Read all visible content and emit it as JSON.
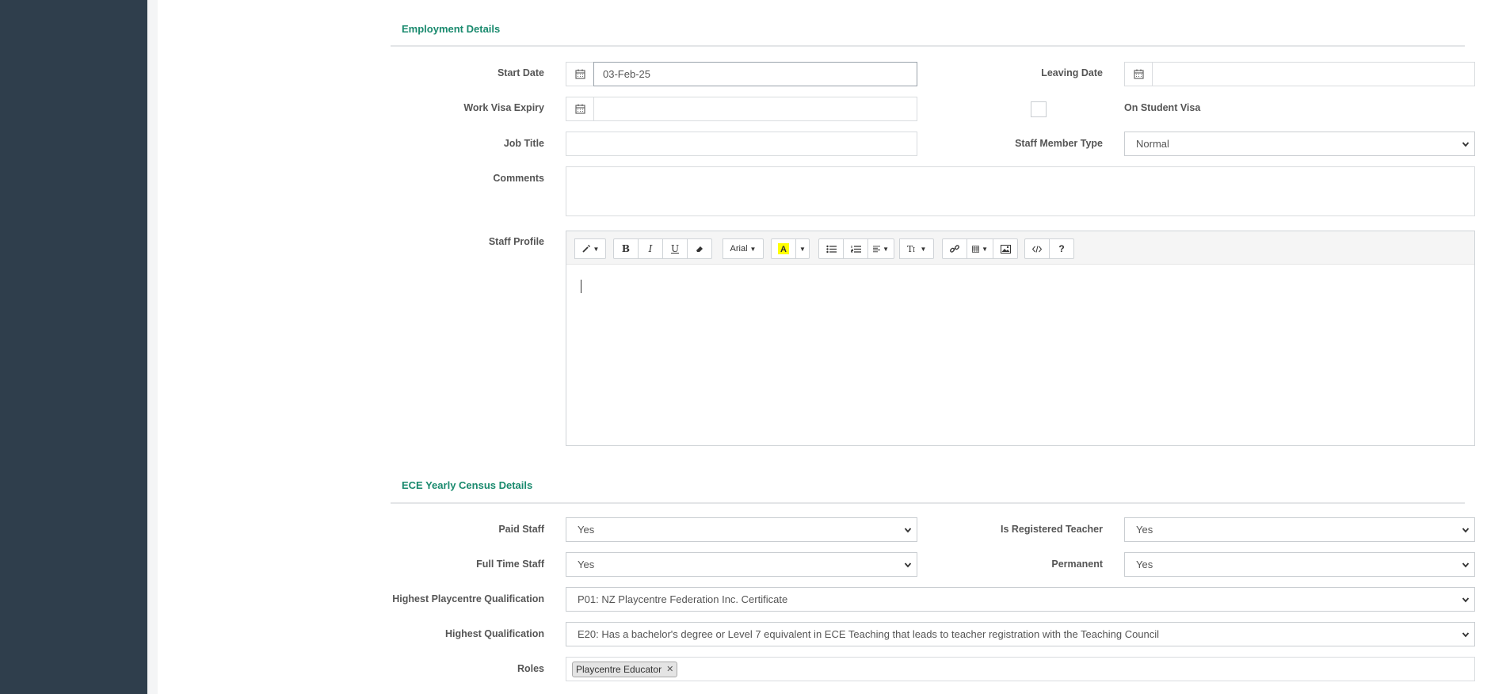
{
  "employment": {
    "title": "Employment Details",
    "start_date_label": "Start Date",
    "start_date_value": "03-Feb-25",
    "leaving_date_label": "Leaving Date",
    "leaving_date_value": "",
    "work_visa_label": "Work Visa Expiry",
    "work_visa_value": "",
    "student_visa_label": "On Student Visa",
    "job_title_label": "Job Title",
    "job_title_value": "",
    "staff_type_label": "Staff Member Type",
    "staff_type_value": "Normal",
    "comments_label": "Comments",
    "profile_label": "Staff Profile"
  },
  "editor": {
    "bold": "B",
    "italic": "I",
    "underline": "U",
    "font_name": "Arial",
    "help": "?"
  },
  "census": {
    "title": "ECE Yearly Census Details",
    "paid_staff_label": "Paid Staff",
    "paid_staff_value": "Yes",
    "registered_teacher_label": "Is Registered Teacher",
    "registered_teacher_value": "Yes",
    "full_time_label": "Full Time Staff",
    "full_time_value": "Yes",
    "permanent_label": "Permanent",
    "permanent_value": "Yes",
    "playcentre_qual_label": "Highest Playcentre Qualification",
    "playcentre_qual_value": "P01: NZ Playcentre Federation Inc. Certificate",
    "highest_qual_label": "Highest Qualification",
    "highest_qual_value": "E20: Has a bachelor's degree or Level 7 equivalent in ECE Teaching that leads to teacher registration with the Teaching Council",
    "roles_label": "Roles",
    "roles": [
      "Playcentre Educator"
    ]
  },
  "colors": {
    "sidebar": "#2f3e4c",
    "section_title": "#1a8a6e",
    "highlight": "#ffff00"
  }
}
